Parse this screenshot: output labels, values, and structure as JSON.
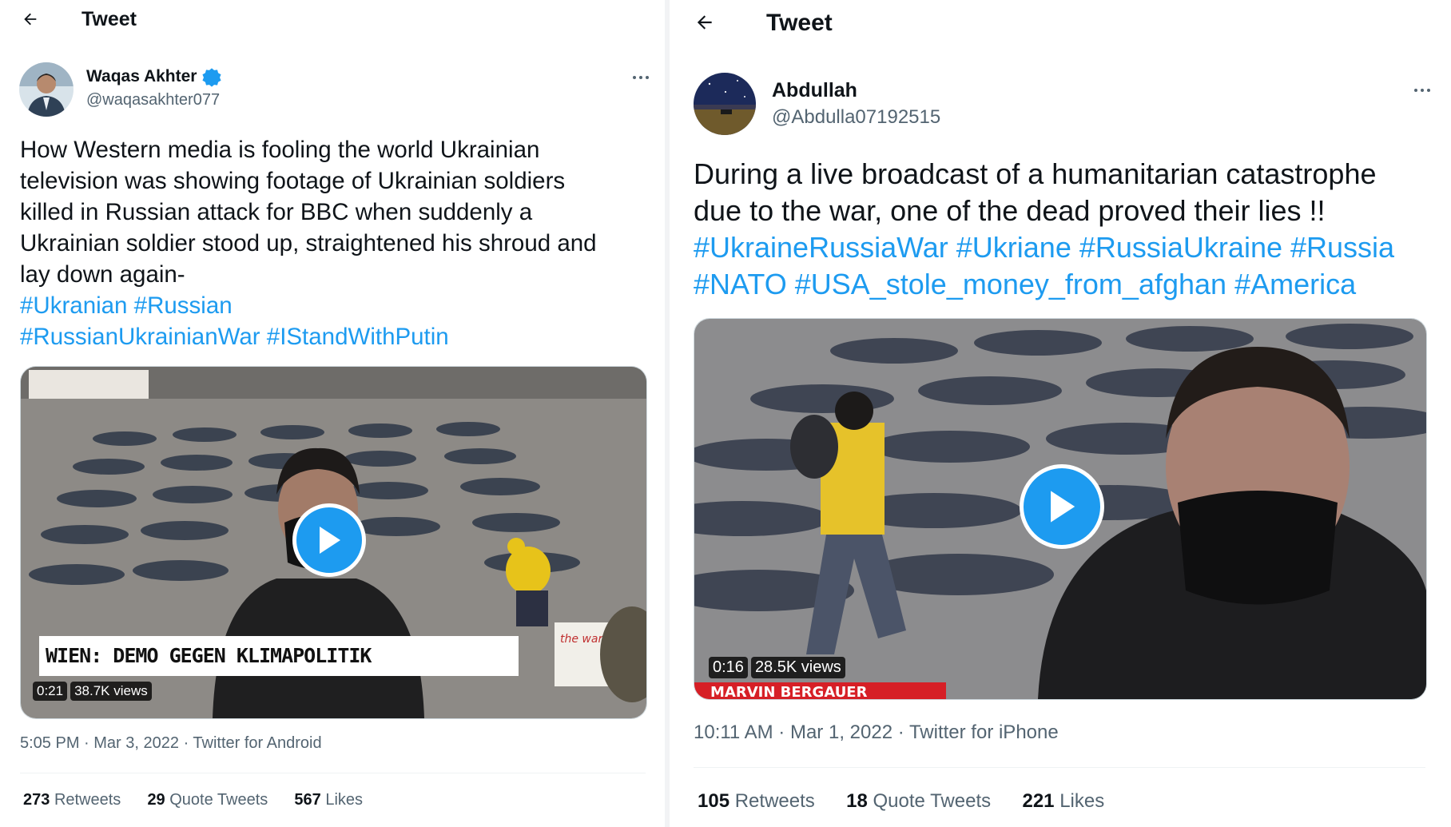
{
  "left_tweet": {
    "header_title": "Tweet",
    "author": {
      "name": "Waqas Akhter",
      "handle": "@waqasakhter077",
      "verified": true
    },
    "text_lines": [
      "How Western media is fooling the world Ukrainian",
      "television was showing footage of Ukrainian soldiers",
      "killed in Russian attack for BBC when suddenly a",
      "Ukrainian soldier stood up, straightened his shroud and",
      "lay down again-"
    ],
    "hashtag_lines": [
      [
        "#Ukranian",
        "#Russian"
      ],
      [
        "#RussianUkrainianWar",
        "#IStandWithPutin"
      ]
    ],
    "video": {
      "duration": "0:21",
      "views": "38.7K views",
      "caption": "WIEN: DEMO GEGEN KLIMAPOLITIK",
      "sign_text": "the war NOT VERK"
    },
    "timestamp": {
      "time": "5:05 PM",
      "date": "Mar 3, 2022",
      "source": "Twitter for Android"
    },
    "stats": {
      "retweets_count": "273",
      "retweets_label": "Retweets",
      "quotes_count": "29",
      "quotes_label": "Quote Tweets",
      "likes_count": "567",
      "likes_label": "Likes"
    }
  },
  "right_tweet": {
    "header_title": "Tweet",
    "author": {
      "name": "Abdullah",
      "handle": "@Abdulla07192515",
      "verified": false
    },
    "text_lines": [
      "During a live broadcast of a humanitarian catastrophe",
      "due to the war, one of the dead proved their lies !!"
    ],
    "hashtag_lines": [
      [
        "#UkraineRussiaWar",
        "#Ukriane",
        "#RussiaUkraine",
        "#Russia"
      ],
      [
        "#NATO",
        "#USA_stole_money_from_afghan",
        "#America"
      ]
    ],
    "video": {
      "duration": "0:16",
      "views": "28.5K views",
      "lower_third": "MARVIN BERGAUER"
    },
    "timestamp": {
      "time": "10:11 AM",
      "date": "Mar 1, 2022",
      "source": "Twitter for iPhone"
    },
    "stats": {
      "retweets_count": "105",
      "retweets_label": "Retweets",
      "quotes_count": "18",
      "quotes_label": "Quote Tweets",
      "likes_count": "221",
      "likes_label": "Likes"
    }
  },
  "colors": {
    "link": "#1d9bf0",
    "text": "#0f1419",
    "secondary": "#536471",
    "divider": "#eff3f4"
  },
  "icons": [
    "back-arrow-icon",
    "verified-badge-icon",
    "more-options-icon",
    "play-icon"
  ]
}
